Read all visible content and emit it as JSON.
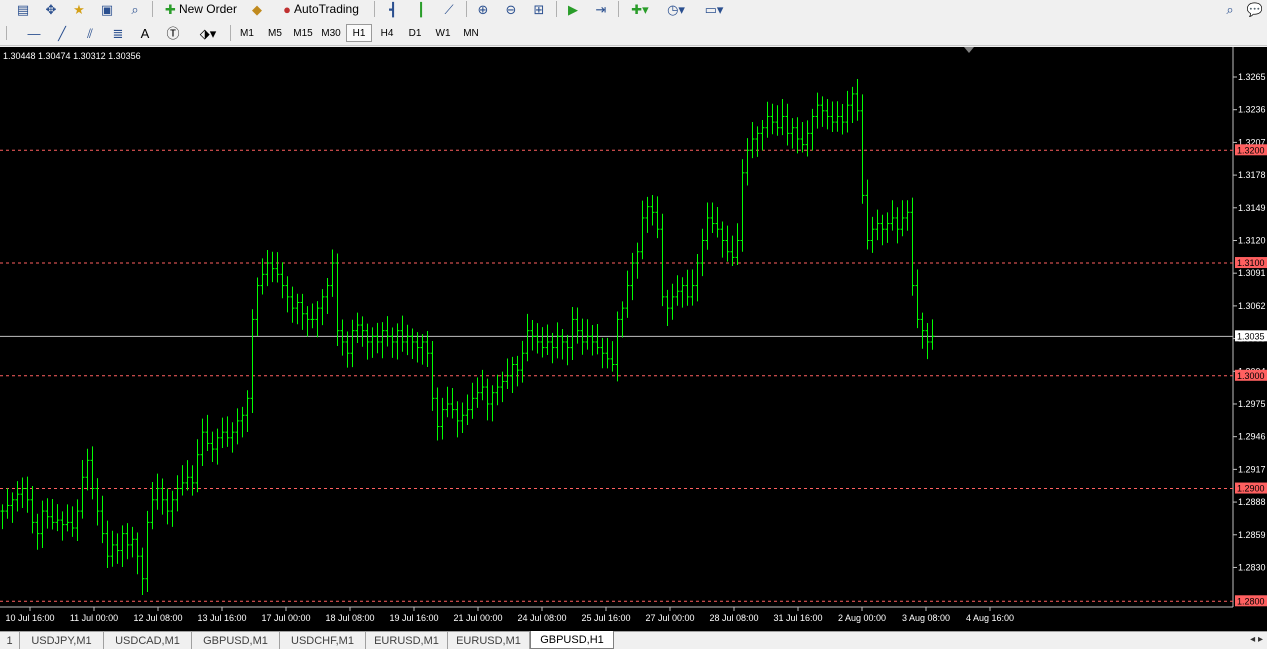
{
  "toolbar": {
    "new_order_label": "New Order",
    "auto_trading_label": "AutoTrading",
    "timeframes": [
      "M1",
      "M5",
      "M15",
      "M30",
      "H1",
      "H4",
      "D1",
      "W1",
      "MN"
    ],
    "active_timeframe": "H1",
    "icons": [
      "new-chart-icon",
      "crosshair-icon",
      "favorites-icon",
      "profiles-icon",
      "zoom-window-icon",
      "new-order-icon",
      "auto-trading-icon",
      "bar-chart-icon",
      "candlestick-icon",
      "line-chart-icon",
      "zoom-in-icon",
      "zoom-out-icon",
      "tile-windows-icon",
      "autoscroll-icon",
      "chart-shift-icon",
      "indicators-icon",
      "periods-icon",
      "templates-icon",
      "search-icon",
      "chat-icon"
    ],
    "drawing_tools": [
      "cursor-line-icon",
      "horizontal-line-icon",
      "trendline-icon",
      "channel-icon",
      "fibonacci-icon",
      "text-icon",
      "text-label-icon",
      "arrows-icon"
    ]
  },
  "chart": {
    "symbol": "GBPUSD",
    "ohlc_text": "1.30448 1.30474 1.30312 1.30356",
    "colors": {
      "background": "#000000",
      "bars": "#00ff00",
      "grid_lines": "#ff6060",
      "price_line": "#c0c0c0",
      "label_bg": "#ff6060"
    }
  },
  "chart_data": {
    "type": "bar",
    "price_axis_ticks": [
      "1.3265",
      "1.3236",
      "1.3207",
      "1.3178",
      "1.3149",
      "1.3120",
      "1.3091",
      "1.3062",
      "1.3033",
      "1.3004",
      "1.2975",
      "1.2946",
      "1.2917",
      "1.2888",
      "1.2859",
      "1.2830"
    ],
    "highlighted_levels": [
      "1.3200",
      "1.3100",
      "1.3000",
      "1.2900",
      "1.2800"
    ],
    "current_price": "1.3035",
    "ylim": [
      1.28,
      1.327
    ],
    "time_axis_labels": [
      "10 Jul 16:00",
      "11 Jul 00:00",
      "12 Jul 08:00",
      "13 Jul 16:00",
      "17 Jul 00:00",
      "18 Jul 08:00",
      "19 Jul 16:00",
      "21 Jul 00:00",
      "24 Jul 08:00",
      "25 Jul 16:00",
      "27 Jul 00:00",
      "28 Jul 08:00",
      "31 Jul 16:00",
      "2 Aug 00:00",
      "3 Aug 08:00",
      "4 Aug 16:00"
    ],
    "series": [
      {
        "close": [
          1.288,
          1.2885,
          1.289,
          1.2895,
          1.29,
          1.289,
          1.287,
          1.286,
          1.288,
          1.2875,
          1.287,
          1.2872,
          1.2868,
          1.287,
          1.2865,
          1.288,
          1.291,
          1.2925,
          1.29,
          1.288,
          1.286,
          1.284,
          1.285,
          1.2845,
          1.286,
          1.285,
          1.2855,
          1.284,
          1.282,
          1.287,
          1.289,
          1.29,
          1.289,
          1.288,
          1.289,
          1.29,
          1.2905,
          1.291,
          1.2905,
          1.293,
          1.295,
          1.294,
          1.2935,
          1.2945,
          1.295,
          1.2945,
          1.295,
          1.296,
          1.2965,
          1.298,
          1.305,
          1.308,
          1.309,
          1.31,
          1.3095,
          1.309,
          1.308,
          1.307,
          1.306,
          1.3065,
          1.3055,
          1.305,
          1.305,
          1.306,
          1.307,
          1.308,
          1.31,
          1.304,
          1.303,
          1.302,
          1.304,
          1.3045,
          1.304,
          1.303,
          1.3035,
          1.303,
          1.304,
          1.3035,
          1.303,
          1.304,
          1.303,
          1.3035,
          1.303,
          1.3025,
          1.303,
          1.302,
          1.298,
          1.2955,
          1.297,
          1.2975,
          1.297,
          1.296,
          1.2965,
          1.297,
          1.298,
          1.2985,
          1.299,
          1.2975,
          1.2985,
          1.299,
          1.2995,
          1.3,
          1.301,
          1.3005,
          1.302,
          1.304,
          1.3035,
          1.303,
          1.3025,
          1.303,
          1.3025,
          1.3035,
          1.303,
          1.3025,
          1.305,
          1.304,
          1.303,
          1.3035,
          1.303,
          1.3025,
          1.302,
          1.3015,
          1.301,
          1.305,
          1.306,
          1.308,
          1.31,
          1.311,
          1.314,
          1.315,
          1.3145,
          1.313,
          1.307,
          1.306,
          1.307,
          1.3075,
          1.308,
          1.307,
          1.308,
          1.31,
          1.312,
          1.314,
          1.3135,
          1.313,
          1.312,
          1.311,
          1.3105,
          1.312,
          1.318,
          1.32,
          1.321,
          1.3215,
          1.322,
          1.323,
          1.3225,
          1.322,
          1.323,
          1.3215,
          1.322,
          1.321,
          1.3205,
          1.3215,
          1.323,
          1.324,
          1.3235,
          1.323,
          1.3225,
          1.323,
          1.3225,
          1.324,
          1.325,
          1.3235,
          1.316,
          1.312,
          1.313,
          1.3135,
          1.313,
          1.3135,
          1.314,
          1.313,
          1.314,
          1.3145,
          1.308,
          1.305,
          1.304,
          1.303,
          1.3035
        ]
      }
    ]
  },
  "tabs": [
    "1",
    "USDJPY,M1",
    "USDCAD,M1",
    "GBPUSD,M1",
    "USDCHF,M1",
    "EURUSD,M1",
    "EURUSD,M1",
    "GBPUSD,H1"
  ],
  "active_tab": "GBPUSD,H1"
}
